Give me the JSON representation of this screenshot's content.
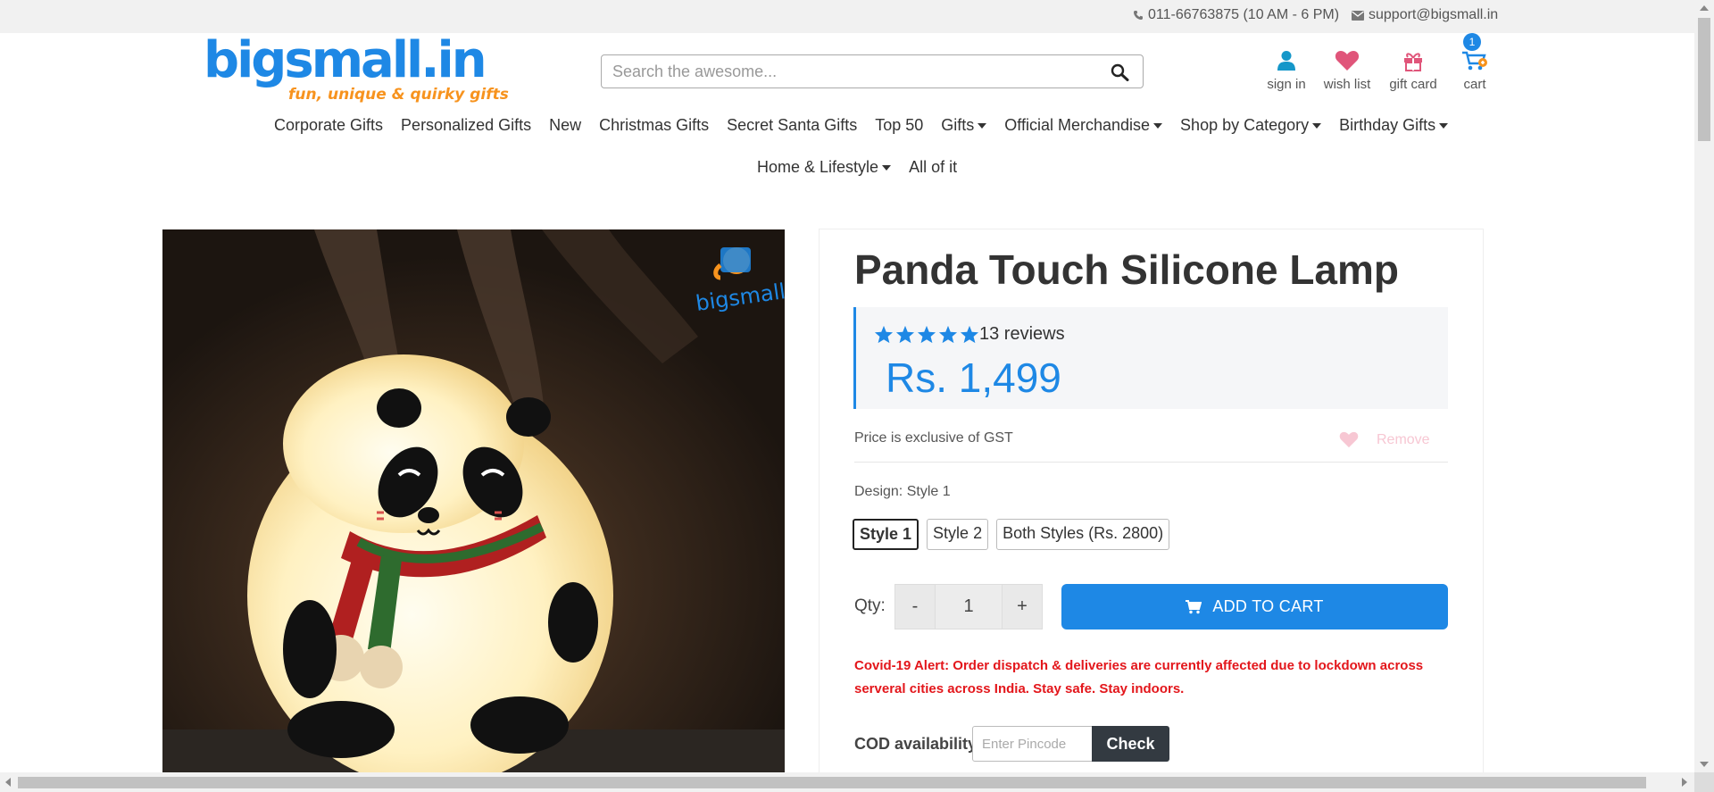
{
  "topbar": {
    "phone": "011-66763875 (10 AM - 6 PM)",
    "email": "support@bigsmall.in"
  },
  "logo": {
    "name": "bigsmall.in",
    "tagline": "fun, unique & quirky gifts"
  },
  "search": {
    "placeholder": "Search the awesome..."
  },
  "header_actions": {
    "sign_in": "sign in",
    "wish_list": "wish list",
    "gift_card": "gift card",
    "cart": "cart",
    "cart_count": "1"
  },
  "nav": {
    "row1": [
      {
        "label": "Corporate Gifts",
        "dropdown": false
      },
      {
        "label": "Personalized Gifts",
        "dropdown": false
      },
      {
        "label": "New",
        "dropdown": false
      },
      {
        "label": "Christmas Gifts",
        "dropdown": false
      },
      {
        "label": "Secret Santa Gifts",
        "dropdown": false
      },
      {
        "label": "Top 50",
        "dropdown": false
      },
      {
        "label": "Gifts",
        "dropdown": true
      },
      {
        "label": "Official Merchandise",
        "dropdown": true
      },
      {
        "label": "Shop by Category",
        "dropdown": true
      },
      {
        "label": "Birthday Gifts",
        "dropdown": true
      }
    ],
    "row2": [
      {
        "label": "Home & Lifestyle",
        "dropdown": true
      },
      {
        "label": "All of it",
        "dropdown": false
      }
    ]
  },
  "product": {
    "title": "Panda Touch Silicone Lamp",
    "rating": 5,
    "reviews": "13 reviews",
    "price": "Rs. 1,499",
    "gst_note": "Price is exclusive of GST",
    "wishlist_action": "Remove",
    "design_label": "Design: Style 1",
    "design_options": [
      "Style 1",
      "Style 2",
      "Both Styles (Rs. 2800)"
    ],
    "selected_design": "Style 1",
    "qty_label": "Qty:",
    "qty_minus": "-",
    "qty_value": "1",
    "qty_plus": "+",
    "add_to_cart": "ADD TO CART",
    "covid_alert": "Covid-19 Alert: Order dispatch & deliveries are currently affected due to lockdown across serveral cities across India. Stay safe. Stay indoors.",
    "cod_label": "COD availability",
    "pincode_placeholder": "Enter Pincode",
    "check_label": "Check",
    "image_watermark": "bigsmall"
  },
  "colors": {
    "brand_blue": "#1e88e5",
    "brand_orange": "#f7931e",
    "alert_red": "#e3161b",
    "wishlist_pink": "#e0557a",
    "dark_button": "#333a41"
  },
  "icons": {
    "phone": "phone-icon",
    "email": "envelope-icon",
    "search": "search-icon",
    "sign_in": "user-icon",
    "wish_list": "heart-icon",
    "gift_card": "gift-icon",
    "cart": "cart-icon"
  }
}
